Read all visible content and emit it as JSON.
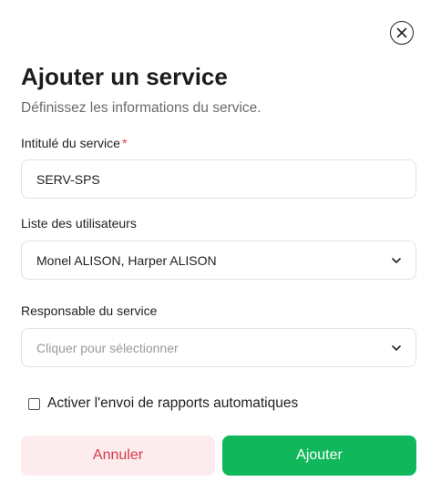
{
  "modal": {
    "title": "Ajouter un service",
    "subtitle": "Définissez les informations du service.",
    "close_icon": "close-circle-icon"
  },
  "form": {
    "service_name": {
      "label": "Intitulé du service",
      "required_mark": "*",
      "value": "SERV-SPS"
    },
    "users": {
      "label": "Liste des utilisateurs",
      "value": "Monel ALISON, Harper ALISON",
      "icon": "chevron-down-icon"
    },
    "manager": {
      "label": "Responsable du service",
      "placeholder": "Cliquer pour sélectionner",
      "icon": "chevron-down-icon"
    },
    "auto_reports": {
      "label": "Activer l'envoi de rapports automatiques",
      "checked": false
    }
  },
  "actions": {
    "cancel_label": "Annuler",
    "submit_label": "Ajouter"
  },
  "colors": {
    "primary": "#11b85b",
    "danger_text": "#d63b45",
    "danger_bg": "#fdeced",
    "required": "#e0394a"
  }
}
